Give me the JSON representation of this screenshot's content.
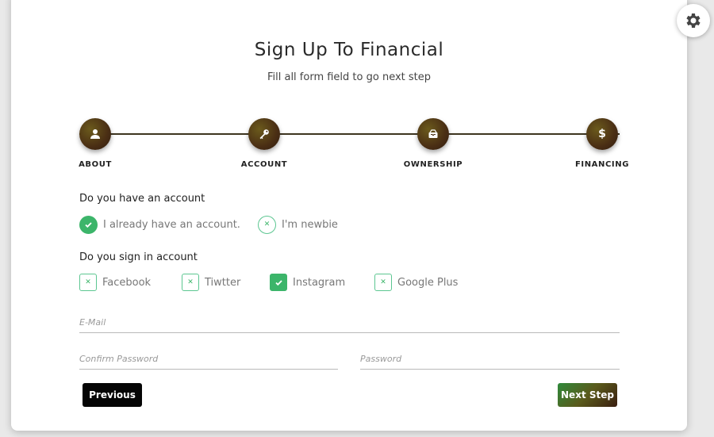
{
  "header": {
    "title": "Sign Up To Financial",
    "subtitle": "Fill all form field to go next step"
  },
  "steps": [
    {
      "label": "ABOUT",
      "icon": "user-icon"
    },
    {
      "label": "ACCOUNT",
      "icon": "key-icon"
    },
    {
      "label": "OWNERSHIP",
      "icon": "mailbox-icon"
    },
    {
      "label": "FINANCING",
      "icon": "dollar-icon"
    }
  ],
  "account_question": {
    "label": "Do you have an account",
    "options": [
      {
        "label": "I already have an account.",
        "selected": true
      },
      {
        "label": "I'm newbie",
        "selected": false
      }
    ]
  },
  "signin_question": {
    "label": "Do you sign in account",
    "options": [
      {
        "label": "Facebook",
        "checked": false
      },
      {
        "label": "Tiwtter",
        "checked": false
      },
      {
        "label": "Instagram",
        "checked": true
      },
      {
        "label": "Google Plus",
        "checked": false
      }
    ]
  },
  "fields": {
    "email_placeholder": "E-Mail",
    "confirm_password_placeholder": "Confirm Password",
    "password_placeholder": "Password"
  },
  "buttons": {
    "previous": "Previous",
    "next": "Next Step"
  },
  "colors": {
    "accent_green": "#3cb56a",
    "step_brown": "#4a2e14",
    "line": "#3d3520"
  }
}
